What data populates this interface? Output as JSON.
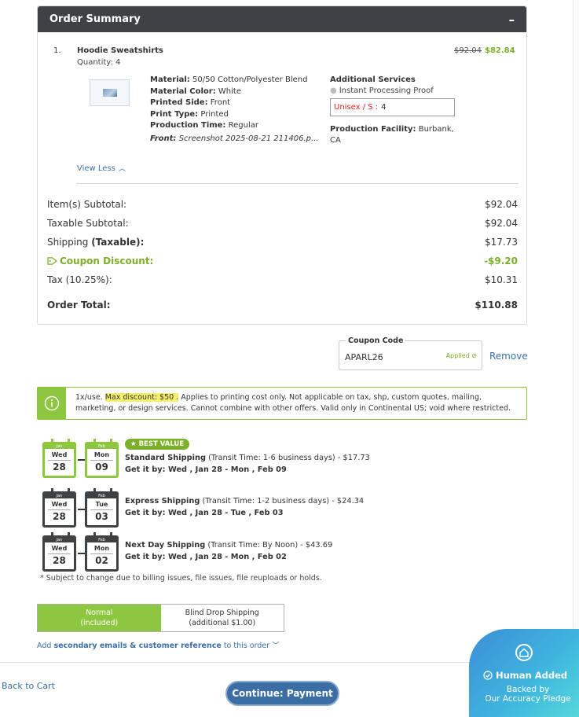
{
  "summary": {
    "title": "Order Summary",
    "collapse_label": "–",
    "item": {
      "index": "1.",
      "name": "Hoodie Sweatshirts",
      "quantity": "Quantity: 4",
      "old_price": "$92.04",
      "new_price": "$82.84",
      "material_label": "Material:",
      "material": "50/50 Cotton/Polyester Blend",
      "color_label": "Material Color:",
      "color": "White",
      "printed_side_label": "Printed Side:",
      "printed_side": "Front",
      "print_type_label": "Print Type:",
      "print_type": "Printed",
      "production_time_label": "Production Time:",
      "production_time": "Regular",
      "front_label": "Front:",
      "front_file": "Screenshot 2025-08-21 211406.p...",
      "additional_services_title": "Additional Services",
      "additional_service": "Instant Processing Proof",
      "size_label": "Unisex / S :",
      "size_qty": "4",
      "facility_label": "Production Facility:",
      "facility": "Burbank, CA"
    },
    "view_less": "View Less"
  },
  "totals": {
    "items_subtotal_label": "Item(s) Subtotal:",
    "items_subtotal": "$92.04",
    "taxable_subtotal_label": "Taxable Subtotal:",
    "taxable_subtotal": "$92.04",
    "shipping_label": "Shipping",
    "shipping_taxable": "(Taxable):",
    "shipping": "$17.73",
    "coupon_label": "Coupon Discount:",
    "coupon": "-$9.20",
    "tax_label": "Tax (10.25%):",
    "tax": "$10.31",
    "order_total_label": "Order Total:",
    "order_total": "$110.88"
  },
  "coupon": {
    "label": "Coupon Code",
    "value": "APARL26",
    "status": "Applied",
    "remove": "Remove"
  },
  "notice": {
    "prefix": "1x/use.",
    "highlight": "Max discount: $50 .",
    "rest": "Applies to printing cost only. Not applicable on tax, shp, custom quotes, mailing, marketing, or design services. Cannot combine with other offers. Valid only in Continental US; void where restricted."
  },
  "shipping_options": [
    {
      "badge": "★ BEST VALUE",
      "start_month": "Jan",
      "start_day": "Wed",
      "start_date": "28",
      "end_month": "Feb",
      "end_day": "Mon",
      "end_date": "09",
      "name": "Standard Shipping",
      "detail": "(Transit Time: 1-6 business days) - $17.73",
      "eta": "Get it by: Wed , Jan 28 - Mon , Feb 09"
    },
    {
      "start_month": "Jan",
      "start_day": "Wed",
      "start_date": "28",
      "end_month": "Feb",
      "end_day": "Tue",
      "end_date": "03",
      "name": "Express Shipping",
      "detail": "(Transit Time: 1-2 business days) - $24.34",
      "eta": "Get it by: Wed , Jan 28 - Tue , Feb 03"
    },
    {
      "start_month": "Jan",
      "start_day": "Wed",
      "start_date": "28",
      "end_month": "Feb",
      "end_day": "Mon",
      "end_date": "02",
      "name": "Next Day Shipping",
      "detail": "(Transit Time: By Noon) - $43.69",
      "eta": "Get it by: Wed , Jan 28 - Mon , Feb 02"
    }
  ],
  "footnote": "* Subject to change due to billing issues, file issues, file reuploads or holds.",
  "drop_toggle": {
    "normal_line1": "Normal",
    "normal_line2": "(included)",
    "blind_line1": "Blind Drop Shipping",
    "blind_line2": "(additional $1.00)"
  },
  "secondary": {
    "prefix": "Add",
    "bold": "secondary emails & customer reference",
    "suffix": "to this order"
  },
  "nav": {
    "back": "Back to Cart",
    "continue": "Continue: Payment"
  },
  "badge": {
    "title": "Human Added",
    "line1": "Backed by",
    "line2": "Our Accuracy Pledge"
  },
  "colors": {
    "accent_green": "#8dc63f",
    "link_blue": "#3b6ea5",
    "header_dark": "#3f4244",
    "error_red": "#dd2222"
  }
}
